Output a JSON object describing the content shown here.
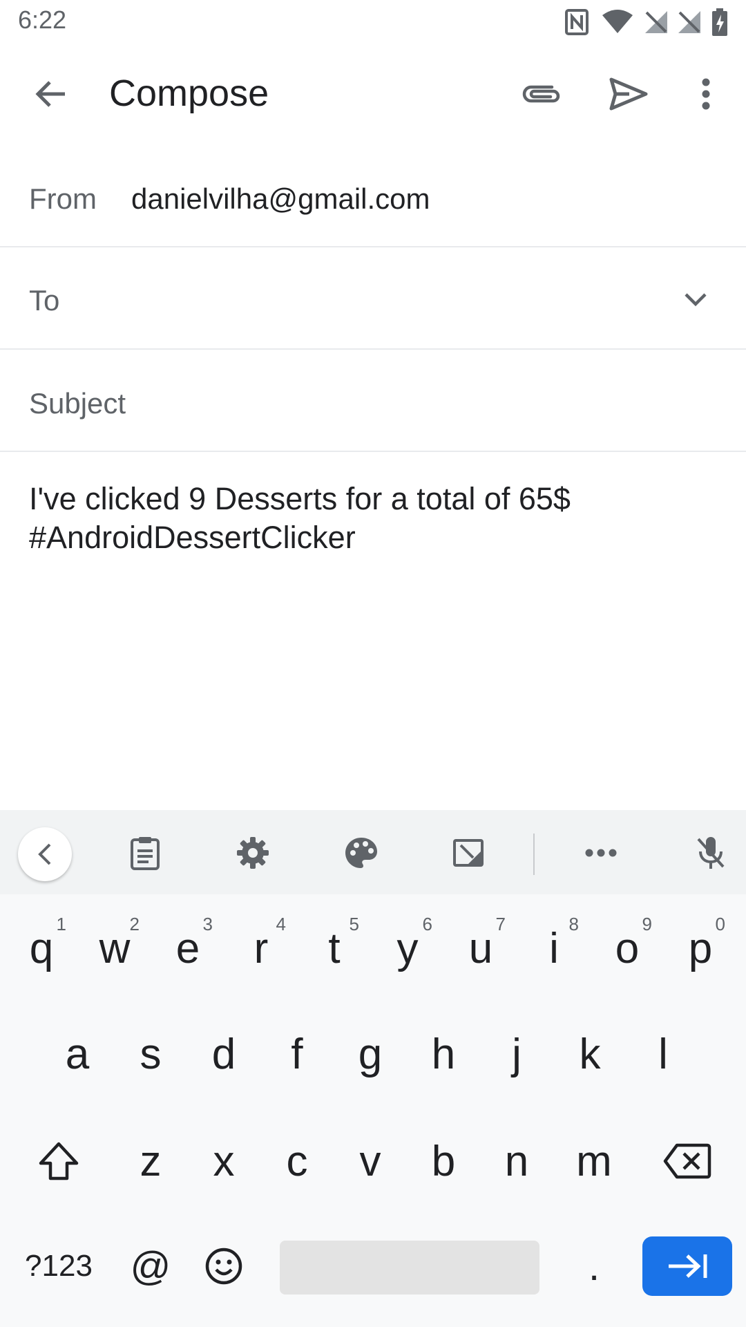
{
  "status_bar": {
    "time": "6:22",
    "icons": [
      "nfc-icon",
      "wifi-icon",
      "signal-off-icon",
      "signal-off-icon",
      "battery-charging-icon"
    ]
  },
  "app_bar": {
    "title": "Compose",
    "back_icon": "arrow-back-icon",
    "attach_icon": "paperclip-icon",
    "send_icon": "send-icon",
    "more_icon": "more-vert-icon"
  },
  "form": {
    "from_label": "From",
    "from_value": "danielvilha@gmail.com",
    "to_label": "To",
    "subject_placeholder": "Subject",
    "body": "I've clicked 9 Desserts for a total of 65$\n#AndroidDessertClicker"
  },
  "keyboard": {
    "toolbar": [
      "chevron-left-icon",
      "clipboard-icon",
      "gear-icon",
      "palette-icon",
      "one-handed-icon",
      "more-horiz-icon",
      "mic-off-icon"
    ],
    "row1": [
      {
        "key": "q",
        "hint": "1"
      },
      {
        "key": "w",
        "hint": "2"
      },
      {
        "key": "e",
        "hint": "3"
      },
      {
        "key": "r",
        "hint": "4"
      },
      {
        "key": "t",
        "hint": "5"
      },
      {
        "key": "y",
        "hint": "6"
      },
      {
        "key": "u",
        "hint": "7"
      },
      {
        "key": "i",
        "hint": "8"
      },
      {
        "key": "o",
        "hint": "9"
      },
      {
        "key": "p",
        "hint": "0"
      }
    ],
    "row2": [
      "a",
      "s",
      "d",
      "f",
      "g",
      "h",
      "j",
      "k",
      "l"
    ],
    "row3": [
      "z",
      "x",
      "c",
      "v",
      "b",
      "n",
      "m"
    ],
    "bottom": {
      "symbols": "?123",
      "at": "@",
      "period": "."
    },
    "accent_color": "#1a73e8"
  }
}
